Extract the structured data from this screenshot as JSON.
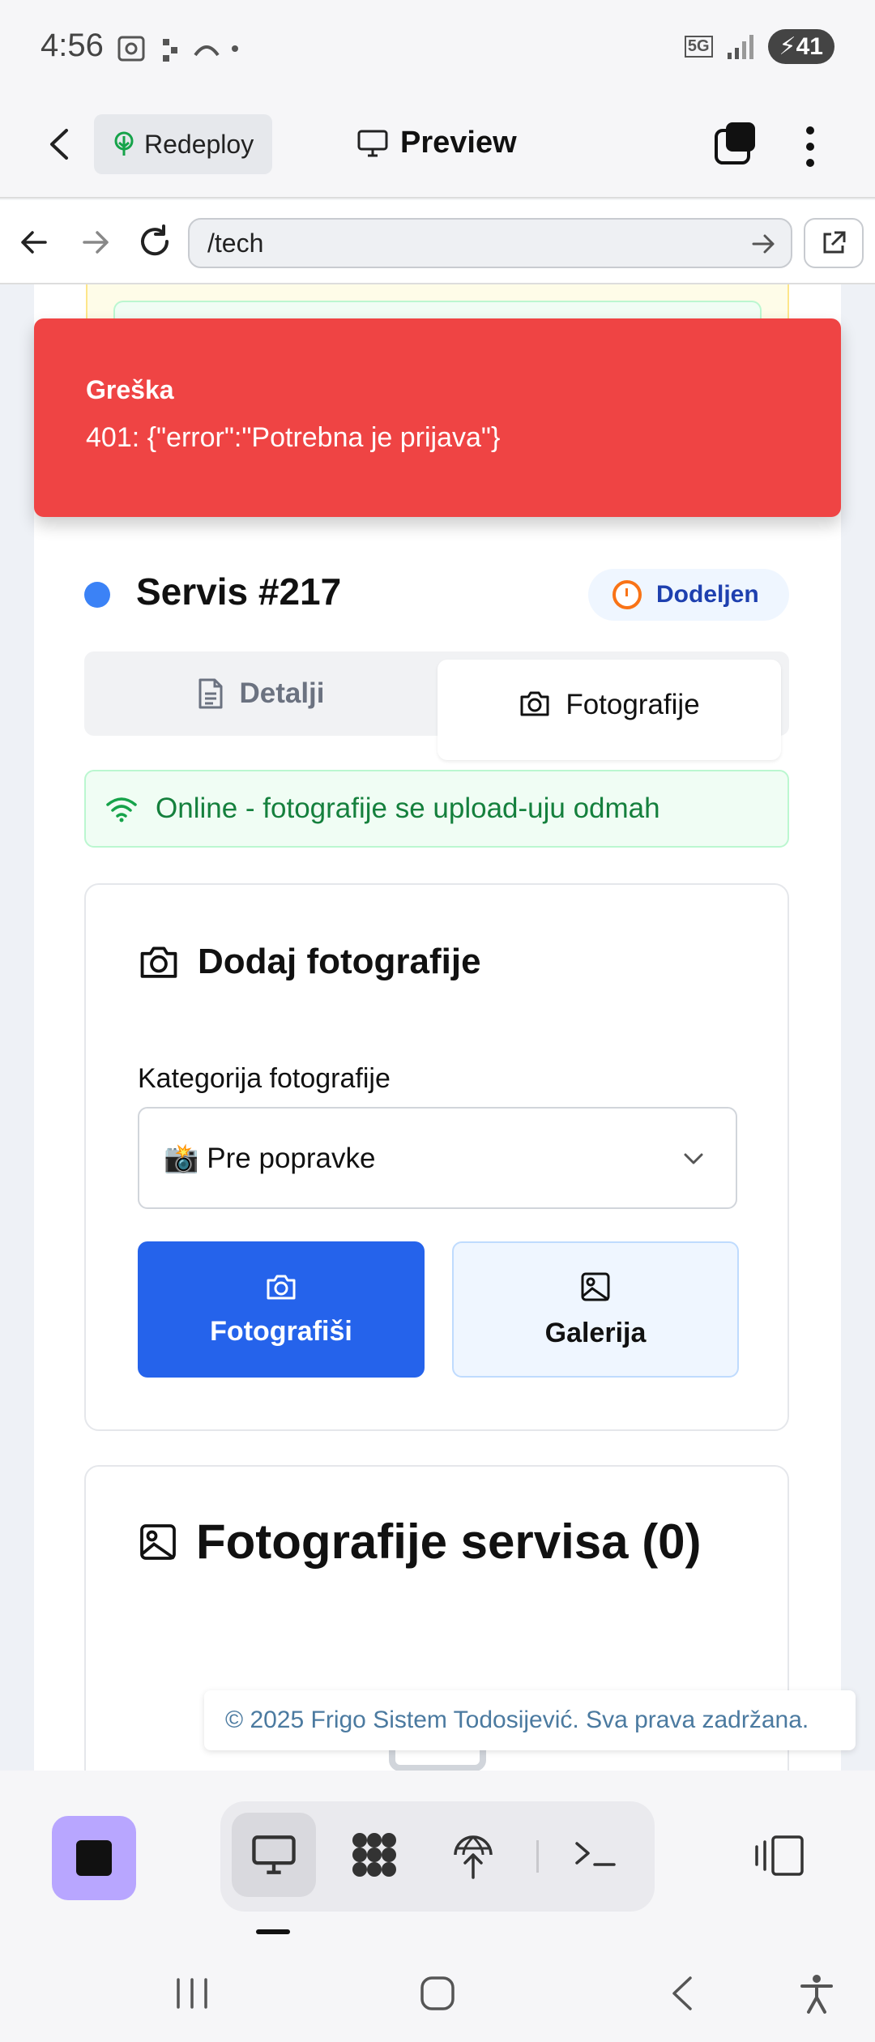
{
  "status_bar": {
    "time": "4:56",
    "network": "5G",
    "battery": "41"
  },
  "app_header": {
    "redeploy_label": "Redeploy",
    "preview_label": "Preview"
  },
  "url_bar": {
    "url": "/tech"
  },
  "toast": {
    "title": "Greška",
    "message": "401: {\"error\":\"Potrebna je prijava\"}"
  },
  "service": {
    "title": "Servis #217",
    "status": "Dodeljen"
  },
  "tabs": [
    {
      "label": "Detalji"
    },
    {
      "label": "Fotografije"
    }
  ],
  "online_banner": "Online - fotografije se upload-uju odmah",
  "add_photos": {
    "heading": "Dodaj fotografije",
    "category_label": "Kategorija fotografije",
    "category_value": "📸 Pre popravke",
    "camera_button": "Fotografiši",
    "gallery_button": "Galerija"
  },
  "service_photos": {
    "heading": "Fotografije servisa (0)"
  },
  "footer_note": "© 2025 Frigo Sistem Todosijević. Sva prava zadržana.",
  "colors": {
    "primary": "#2563eb",
    "error": "#ef4444",
    "success": "#15803d",
    "status_dot": "#3b82f6"
  }
}
